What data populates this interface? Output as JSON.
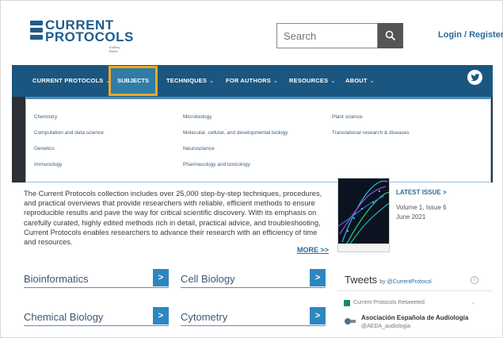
{
  "header": {
    "logo_line1": "CURRENT",
    "logo_line2": "PROTOCOLS",
    "logo_tag": "A Wiley Brand",
    "search_placeholder": "Search",
    "login_label": "Login / Register"
  },
  "nav": {
    "items": [
      {
        "label": "CURRENT PROTOCOLS",
        "chevron": "⌄"
      },
      {
        "label": "SUBJECTS",
        "chevron": "^"
      },
      {
        "label": "TECHNIQUES",
        "chevron": "⌄"
      },
      {
        "label": "FOR AUTHORS",
        "chevron": "⌄"
      },
      {
        "label": "RESOURCES",
        "chevron": "⌄"
      },
      {
        "label": "ABOUT",
        "chevron": "⌄"
      }
    ],
    "twitter_icon": "twitter-icon"
  },
  "dropdown": {
    "col1": [
      "Chemistry",
      "Computation and data science",
      "Genetics",
      "Immunology"
    ],
    "col2": [
      "Microbiology",
      "Molecular, cellular, and developmental biology",
      "Neuroscience",
      "Pharmacology and toxicology"
    ],
    "col3": [
      "Plant science",
      "Translational research & diseases"
    ]
  },
  "main": {
    "intro": "The Current Protocols collection includes over 25,000 step-by-step techniques, procedures, and practical overviews that provide researchers with reliable, efficient methods to ensure reproducible results and pave the way for critical scientific discovery. With its emphasis on carefully curated, highly edited methods rich in detail, practical advice, and troubleshooting, Current Protocols enables researchers to advance their research with an efficiency of time and resources.",
    "more_label": "MORE >>",
    "subjects": [
      "Bioinformatics",
      "Cell Biology",
      "Chemical Biology",
      "Cytometry"
    ],
    "go_glyph": ">"
  },
  "sidebar": {
    "latest_issue": "LATEST ISSUE >",
    "volume": "Volume 1, Issue 6",
    "date": "June 2021",
    "tweets_title": "Tweets",
    "tweets_by": "by",
    "tweets_handle": "@CurrentProtocol",
    "retweeted": "Current Protocols Retweeted",
    "tweet_name": "Asociación Española de Audiología",
    "tweet_handle": "@AEDA_audiologia"
  },
  "colors": {
    "nav_bg": "#1a567f",
    "highlight": "#f0a823",
    "accent": "#2e86c0"
  }
}
